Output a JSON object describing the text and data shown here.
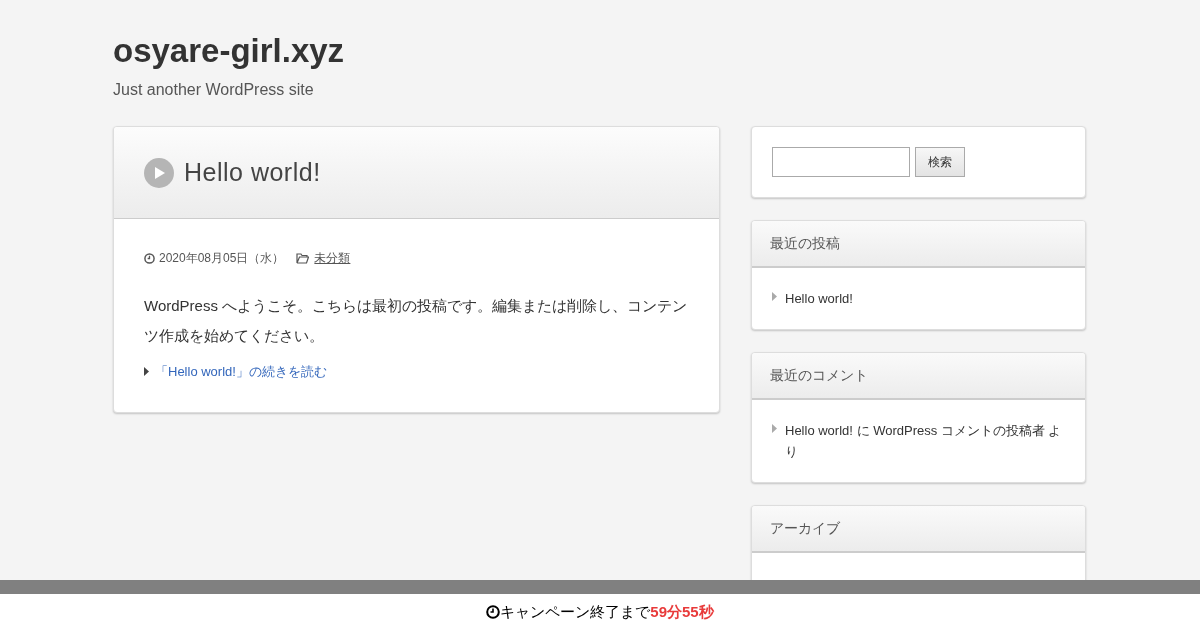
{
  "site": {
    "title": "osyare-girl.xyz",
    "tagline": "Just another WordPress site"
  },
  "post": {
    "title": "Hello world!",
    "date": "2020年08月05日（水）",
    "category": "未分類",
    "body": "WordPress へようこそ。こちらは最初の投稿です。編集または削除し、コンテンツ作成を始めてください。",
    "read_more": "「Hello world!」の続きを読む"
  },
  "sidebar": [
    {
      "kind": "search",
      "button": "検索"
    },
    {
      "kind": "list",
      "title": "最近の投稿",
      "items": [
        "Hello world!"
      ]
    },
    {
      "kind": "list",
      "title": "最近のコメント",
      "items": [
        "Hello world! に WordPress コメントの投稿者 より"
      ]
    },
    {
      "kind": "list",
      "title": "アーカイブ"
    }
  ],
  "footer": {
    "text": "キャンペーン終了まで",
    "countdown": "59分55秒"
  }
}
